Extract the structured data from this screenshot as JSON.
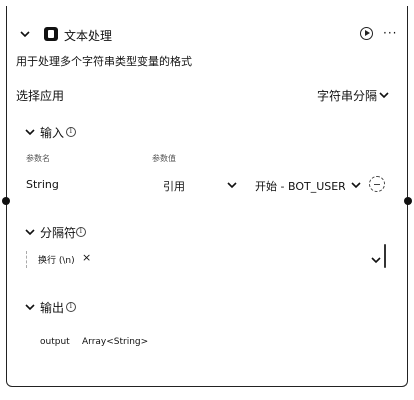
{
  "header": {
    "title": "文本处理",
    "description": "用于处理多个字符串类型变量的格式"
  },
  "app": {
    "label": "选择应用",
    "value": "字符串分隔"
  },
  "input": {
    "section_title": "输入",
    "col_param": "参数名",
    "col_value": "参数值",
    "row": {
      "name": "String",
      "type": "引用",
      "value": "开始 - BOT_USER"
    }
  },
  "separator": {
    "section_title": "分隔符",
    "tag": "换行 (\\n)",
    "tag_remove": "×"
  },
  "output": {
    "section_title": "输出",
    "name": "output",
    "type": "Array<String>"
  },
  "icons": {
    "collapse": "chevron-down-icon",
    "node": "text-node-icon",
    "run": "play-icon",
    "more": "more-icon"
  }
}
